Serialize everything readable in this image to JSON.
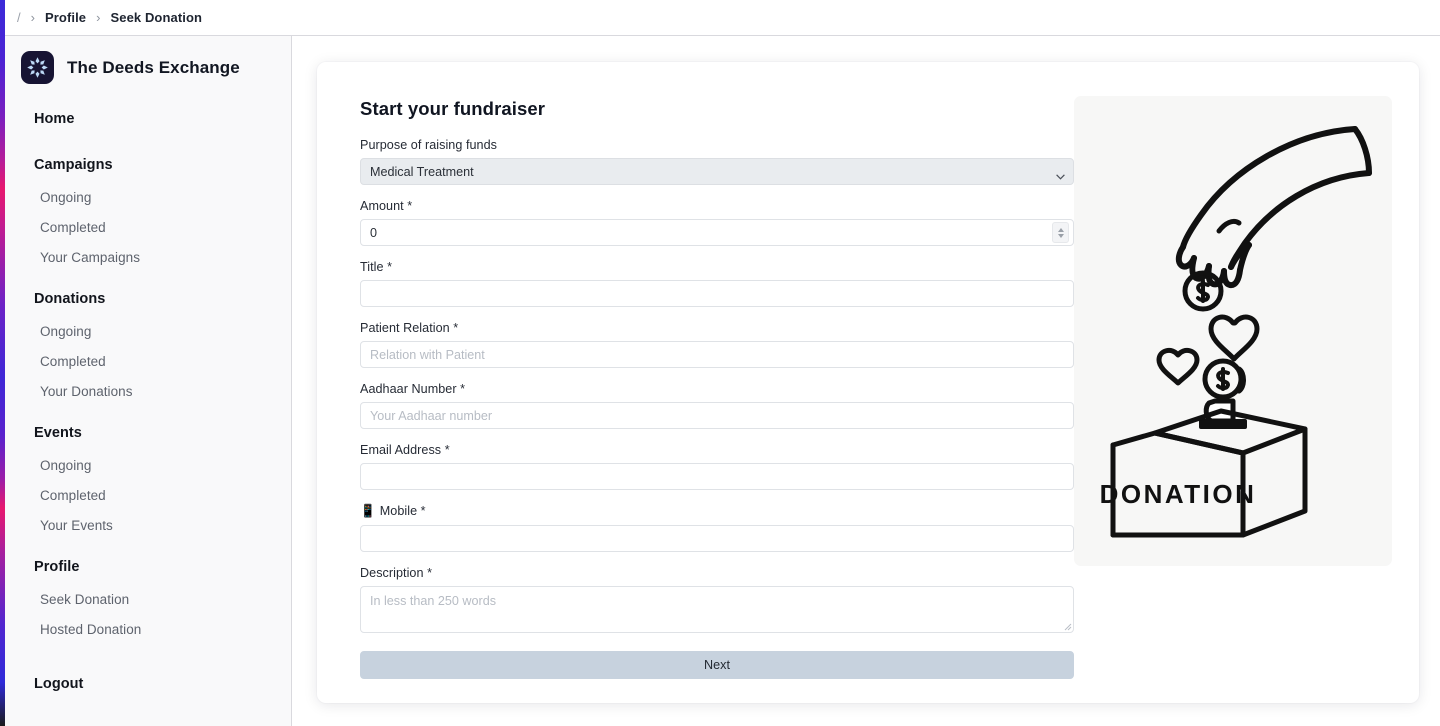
{
  "breadcrumb": {
    "root": "/",
    "separator": "›",
    "items": [
      {
        "label": "Profile"
      },
      {
        "label": "Seek Donation"
      }
    ]
  },
  "brand": {
    "name": "The Deeds Exchange",
    "logo_icon": "burst-logo-icon",
    "logo_bg": "#171433",
    "logo_fg": "#bcd8f5"
  },
  "sidebar": {
    "sections": [
      {
        "type": "head",
        "label": "Home",
        "name": "sidebar-item-home"
      },
      {
        "type": "head",
        "label": "Campaigns",
        "name": "sidebar-group-campaigns"
      },
      {
        "type": "item",
        "label": "Ongoing",
        "name": "sidebar-item-campaigns-ongoing"
      },
      {
        "type": "item",
        "label": "Completed",
        "name": "sidebar-item-campaigns-completed"
      },
      {
        "type": "item",
        "label": "Your Campaigns",
        "name": "sidebar-item-your-campaigns"
      },
      {
        "type": "head",
        "label": "Donations",
        "name": "sidebar-group-donations"
      },
      {
        "type": "item",
        "label": "Ongoing",
        "name": "sidebar-item-donations-ongoing"
      },
      {
        "type": "item",
        "label": "Completed",
        "name": "sidebar-item-donations-completed"
      },
      {
        "type": "item",
        "label": "Your Donations",
        "name": "sidebar-item-your-donations"
      },
      {
        "type": "head",
        "label": "Events",
        "name": "sidebar-group-events"
      },
      {
        "type": "item",
        "label": "Ongoing",
        "name": "sidebar-item-events-ongoing"
      },
      {
        "type": "item",
        "label": "Completed",
        "name": "sidebar-item-events-completed"
      },
      {
        "type": "item",
        "label": "Your Events",
        "name": "sidebar-item-your-events"
      },
      {
        "type": "head",
        "label": "Profile",
        "name": "sidebar-group-profile"
      },
      {
        "type": "item",
        "label": "Seek Donation",
        "name": "sidebar-item-seek-donation"
      },
      {
        "type": "item",
        "label": "Hosted Donation",
        "name": "sidebar-item-hosted-donation"
      },
      {
        "type": "head",
        "label": "Logout",
        "name": "sidebar-item-logout"
      }
    ]
  },
  "form": {
    "title": "Start your fundraiser",
    "purpose": {
      "label": "Purpose of raising funds",
      "value": "Medical Treatment",
      "options": [
        "Medical Treatment"
      ]
    },
    "amount": {
      "label": "Amount *",
      "value": "0"
    },
    "title_field": {
      "label": "Title *",
      "value": "",
      "placeholder": ""
    },
    "patient_relation": {
      "label": "Patient Relation *",
      "value": "",
      "placeholder": "Relation with Patient"
    },
    "aadhaar": {
      "label": "Aadhaar Number *",
      "value": "",
      "placeholder": "Your Aadhaar number"
    },
    "email": {
      "label": "Email Address *",
      "value": "",
      "placeholder": ""
    },
    "mobile": {
      "label": "Mobile *",
      "icon": "📱",
      "value": "",
      "placeholder": ""
    },
    "description": {
      "label": "Description *",
      "value": "",
      "placeholder": "In less than 250 words"
    },
    "next_label": "Next",
    "next_color": "#c7d2de"
  },
  "illustration": {
    "name": "donation-box-illustration",
    "caption": "DONATION",
    "background": "#f7f7f6"
  }
}
